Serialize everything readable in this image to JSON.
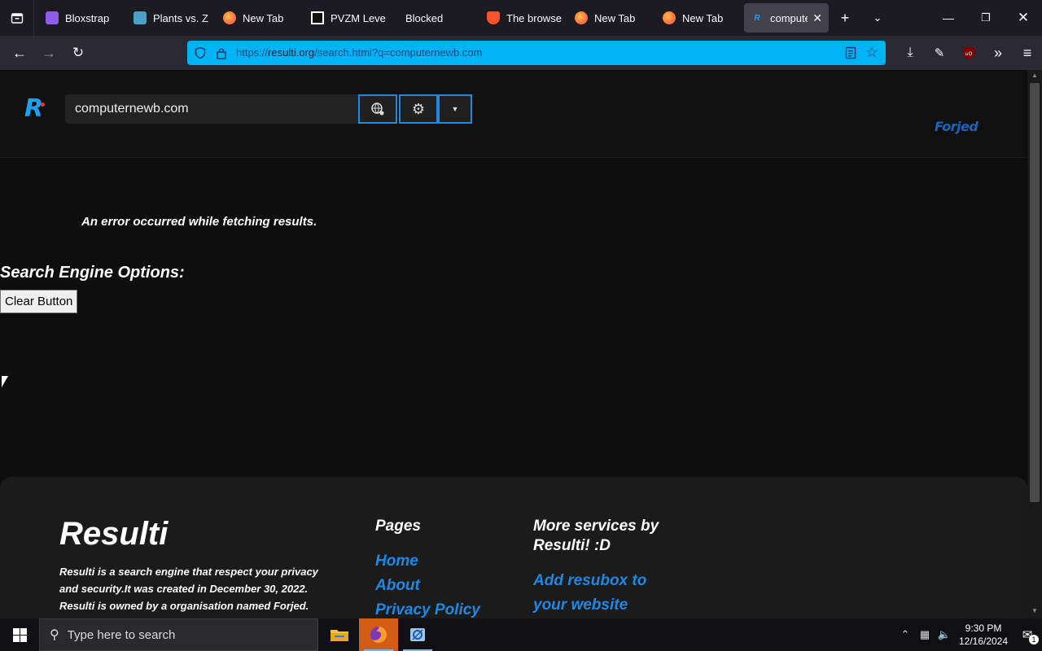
{
  "browser": {
    "tabs": [
      {
        "title": "Bloxstrap",
        "icon": "bloxstrap-icon",
        "color": "#8e5ce8"
      },
      {
        "title": "Plants vs. Z",
        "icon": "pvz-icon",
        "color": "#4aa1c8"
      },
      {
        "title": "New Tab",
        "icon": "firefox-icon",
        "color": "#ff7139"
      },
      {
        "title": "PVZM Level",
        "icon": "pvzm-icon",
        "color": "#ffffff"
      },
      {
        "title": "Blocked",
        "icon": "",
        "color": ""
      },
      {
        "title": "The browse",
        "icon": "brave-icon",
        "color": "#fb542b"
      },
      {
        "title": "New Tab",
        "icon": "firefox-icon",
        "color": "#ff7139"
      },
      {
        "title": "New Tab",
        "icon": "firefox-icon",
        "color": "#ff7139"
      },
      {
        "title": "compute",
        "icon": "resulti-icon",
        "color": "#1da1f2"
      }
    ],
    "url_host": "resulti.org",
    "url_scheme": "https://",
    "url_path": "/search.html?q=computernewb.com",
    "accent": "#00b3f4"
  },
  "page": {
    "logo_letter": "R",
    "search_value": "computernewb.com",
    "partner_logo": "Forjed",
    "error_message": "An error occurred while fetching results.",
    "options_title": "Search Engine Options:",
    "clear_button": "Clear Button",
    "accent": "#1e88e5"
  },
  "footer": {
    "brand": "Resulti",
    "description": "Resulti is a search engine that respect your privacy and security.It was created in December 30, 2022. Resulti is owned by a organisation named Forjed. Proudly from",
    "pages_title": "Pages",
    "pages_links": [
      "Home",
      "About",
      "Privacy Policy"
    ],
    "services_title": "More services by Resulti! :D",
    "services_links": [
      "Add resubox to your website"
    ]
  },
  "taskbar": {
    "search_placeholder": "Type here to search",
    "time": "9:30 PM",
    "date": "12/16/2024",
    "notification_count": "1"
  }
}
